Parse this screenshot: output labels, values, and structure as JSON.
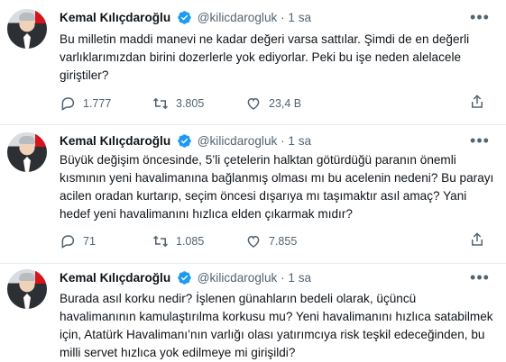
{
  "tweets": [
    {
      "author": {
        "name": "Kemal Kılıçdaroğlu",
        "handle": "@kilicdarogluk",
        "separator": "·",
        "time": "1 sa"
      },
      "text": "Bu milletin maddi manevi ne kadar değeri varsa sattılar. Şimdi de en değerli varlıklarımızdan birini dozerlerle yok ediyorlar. Peki bu işe neden alelacele giriştiler?",
      "actions": {
        "replies": "1.777",
        "retweets": "3.805",
        "likes": "23,4 B"
      }
    },
    {
      "author": {
        "name": "Kemal Kılıçdaroğlu",
        "handle": "@kilicdarogluk",
        "separator": "·",
        "time": "1 sa"
      },
      "text": "Büyük değişim öncesinde, 5’li çetelerin halktan götürdüğü paranın önemli kısmının yeni havalimanına bağlanmış olması mı bu acelenin nedeni? Bu parayı acilen oradan kurtarıp, seçim öncesi dışarıya mı taşımaktır asıl amaç? Yani hedef yeni havalimanını hızlıca elden çıkarmak mıdır?",
      "actions": {
        "replies": "71",
        "retweets": "1.085",
        "likes": "7.855"
      }
    },
    {
      "author": {
        "name": "Kemal Kılıçdaroğlu",
        "handle": "@kilicdarogluk",
        "separator": "·",
        "time": "1 sa"
      },
      "text": "Burada asıl korku nedir? İşlenen günahların bedeli olarak, üçüncü havalimanının kamulaştırılma korkusu mu? Yeni havalimanını hızlıca satabilmek için, Atatürk Havalimanı’nın varlığı olası yatırımcıya risk teşkil edeceğinden, bu milli servet hızlıca yok edilmeye mi girişildi?"
    }
  ],
  "icons": {
    "verified": "verified-badge-icon",
    "reply": "reply-icon",
    "retweet": "retweet-icon",
    "like": "like-icon",
    "share": "share-icon",
    "more": "more-options-icon"
  },
  "colors": {
    "verified": "#1d9bf0",
    "muted": "#536471",
    "text": "#0f1419",
    "divider": "#e6ecf0"
  }
}
